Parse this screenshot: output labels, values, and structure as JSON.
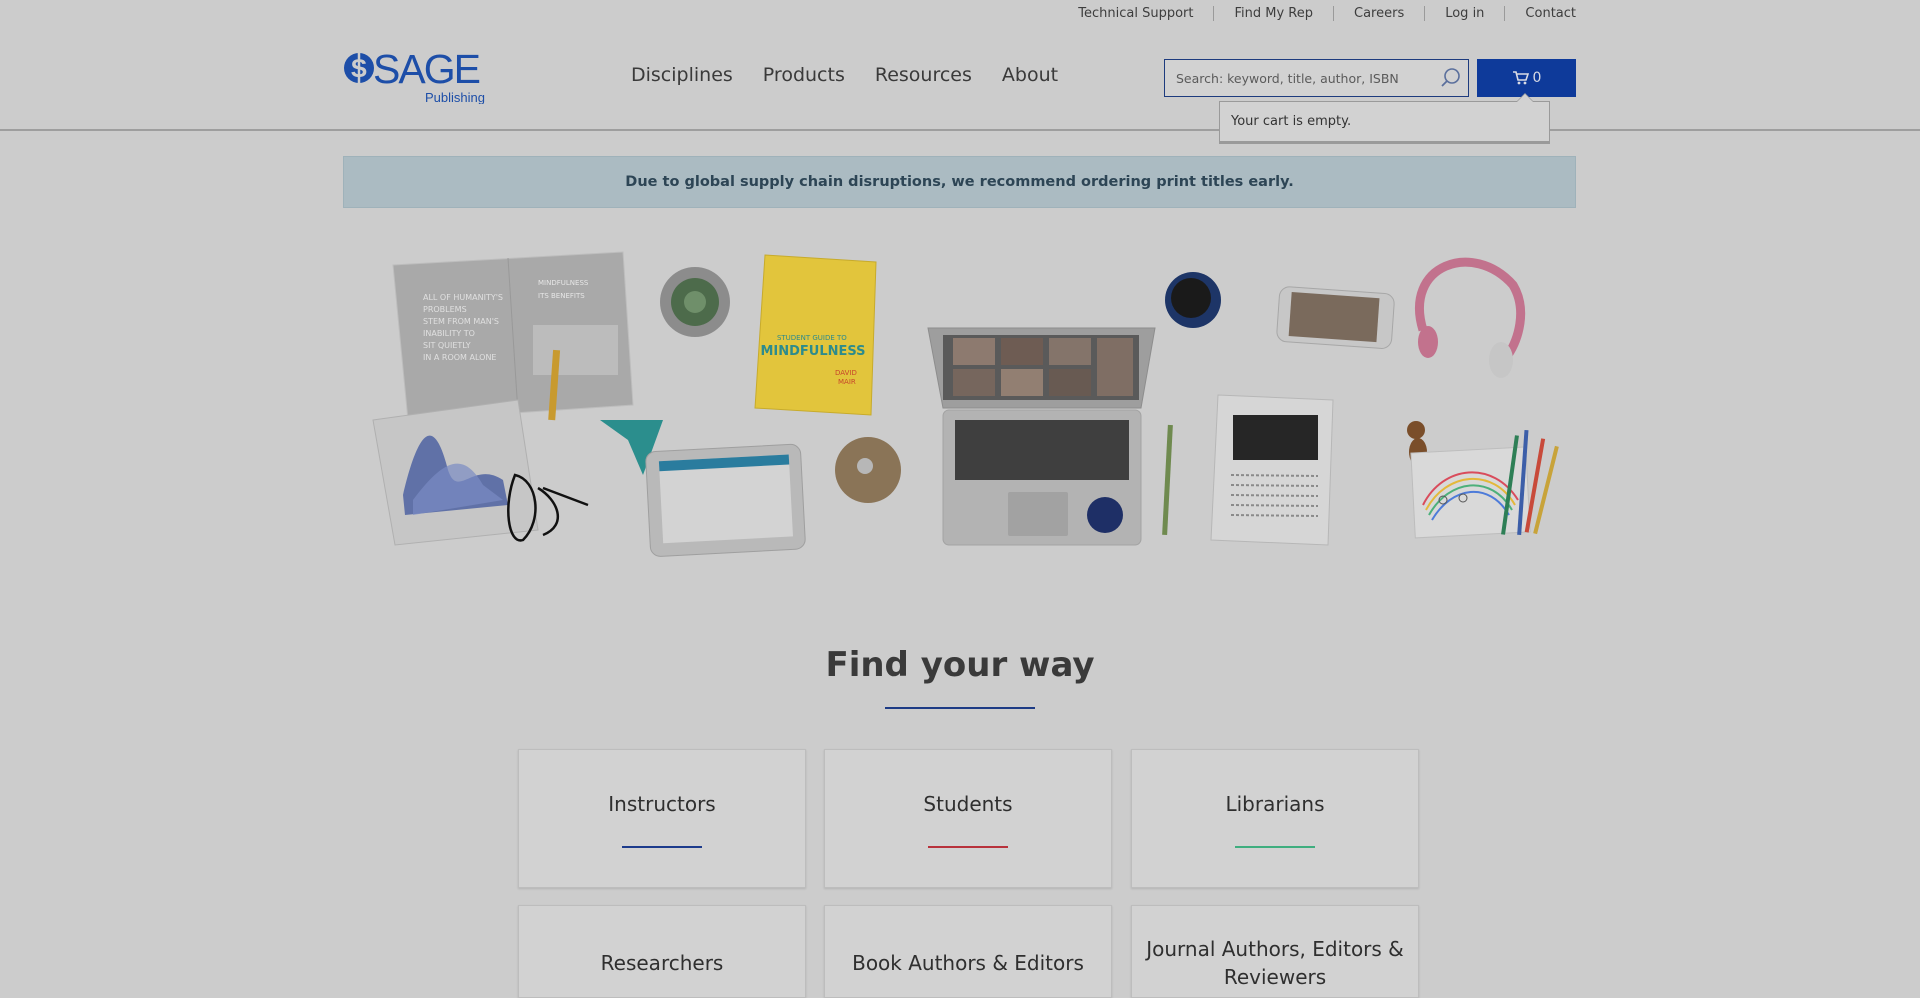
{
  "utility_nav": [
    "Technical Support",
    "Find My Rep",
    "Careers",
    "Log in",
    "Contact"
  ],
  "logo": {
    "name": "SAGE",
    "sub": "Publishing",
    "color": "#1d4ea8"
  },
  "main_nav": [
    "Disciplines",
    "Products",
    "Resources",
    "About"
  ],
  "search": {
    "placeholder": "Search: keyword, title, author, ISBN",
    "value": ""
  },
  "cart": {
    "count": "0",
    "popup_text": "Your cart is empty."
  },
  "notice": {
    "text": "Due to global supply chain disruptions, we recommend ordering print titles early."
  },
  "hero": {
    "book_title": "STUDENT GUIDE TO MINDFULNESS",
    "book_author": "DAVID MAIR",
    "leaflet_headline": "ALL OF HUMANITY'S PROBLEMS STEM FROM MAN'S INABILITY TO SIT QUIETLY IN A ROOM ALONE",
    "leaflet_side": "MINDFULNESS ITS BENEFITS"
  },
  "find_your_way": {
    "title": "Find your way",
    "cards": [
      {
        "label": "Instructors",
        "accent": "#1d3b8c"
      },
      {
        "label": "Students",
        "accent": "#b8323c"
      },
      {
        "label": "Librarians",
        "accent": "#3fae7f"
      },
      {
        "label": "Researchers",
        "accent": ""
      },
      {
        "label": "Book Authors & Editors",
        "accent": ""
      },
      {
        "label": "Journal Authors, Editors & Reviewers",
        "accent": ""
      }
    ]
  },
  "colors": {
    "brand_blue": "#0e3a9a",
    "overlay_bg": "#cccccc"
  }
}
